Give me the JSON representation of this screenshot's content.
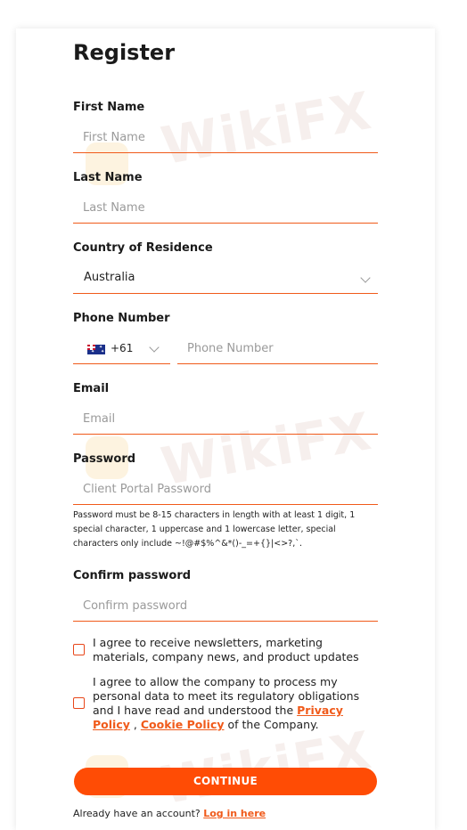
{
  "form": {
    "title": "Register",
    "first_name": {
      "label": "First Name",
      "placeholder": "First Name"
    },
    "last_name": {
      "label": "Last Name",
      "placeholder": "Last Name"
    },
    "country": {
      "label": "Country of Residence",
      "value": "Australia"
    },
    "phone": {
      "label": "Phone Number",
      "code": "+61",
      "placeholder": "Phone Number"
    },
    "email": {
      "label": "Email",
      "placeholder": "Email"
    },
    "password": {
      "label": "Password",
      "placeholder": "Client Portal Password",
      "hint": "Password must be 8-15 characters in length with at least 1 digit, 1 special character, 1 uppercase and 1 lowercase letter, special characters only include ~!@#$%^&*()-_=+{}|<>?,`."
    },
    "confirm_password": {
      "label": "Confirm password",
      "placeholder": "Confirm password"
    },
    "consent_newsletter": "I agree to receive newsletters, marketing materials, company news, and product updates",
    "consent_data": {
      "prefix": "I agree to allow the company to process my personal data to meet its regulatory obligations and I have read and understood the",
      "privacy_link": "Privacy Policy",
      "separator": ",",
      "cookie_link": "Cookie Policy",
      "suffix": "of the Company."
    },
    "continue_label": "CONTINUE",
    "bottom_prefix": "Already have an account?",
    "bottom_link": "Log in here"
  },
  "watermark": "WikiFX",
  "colors": {
    "accent": "#ff4c05",
    "underline": "#f05a1a"
  }
}
